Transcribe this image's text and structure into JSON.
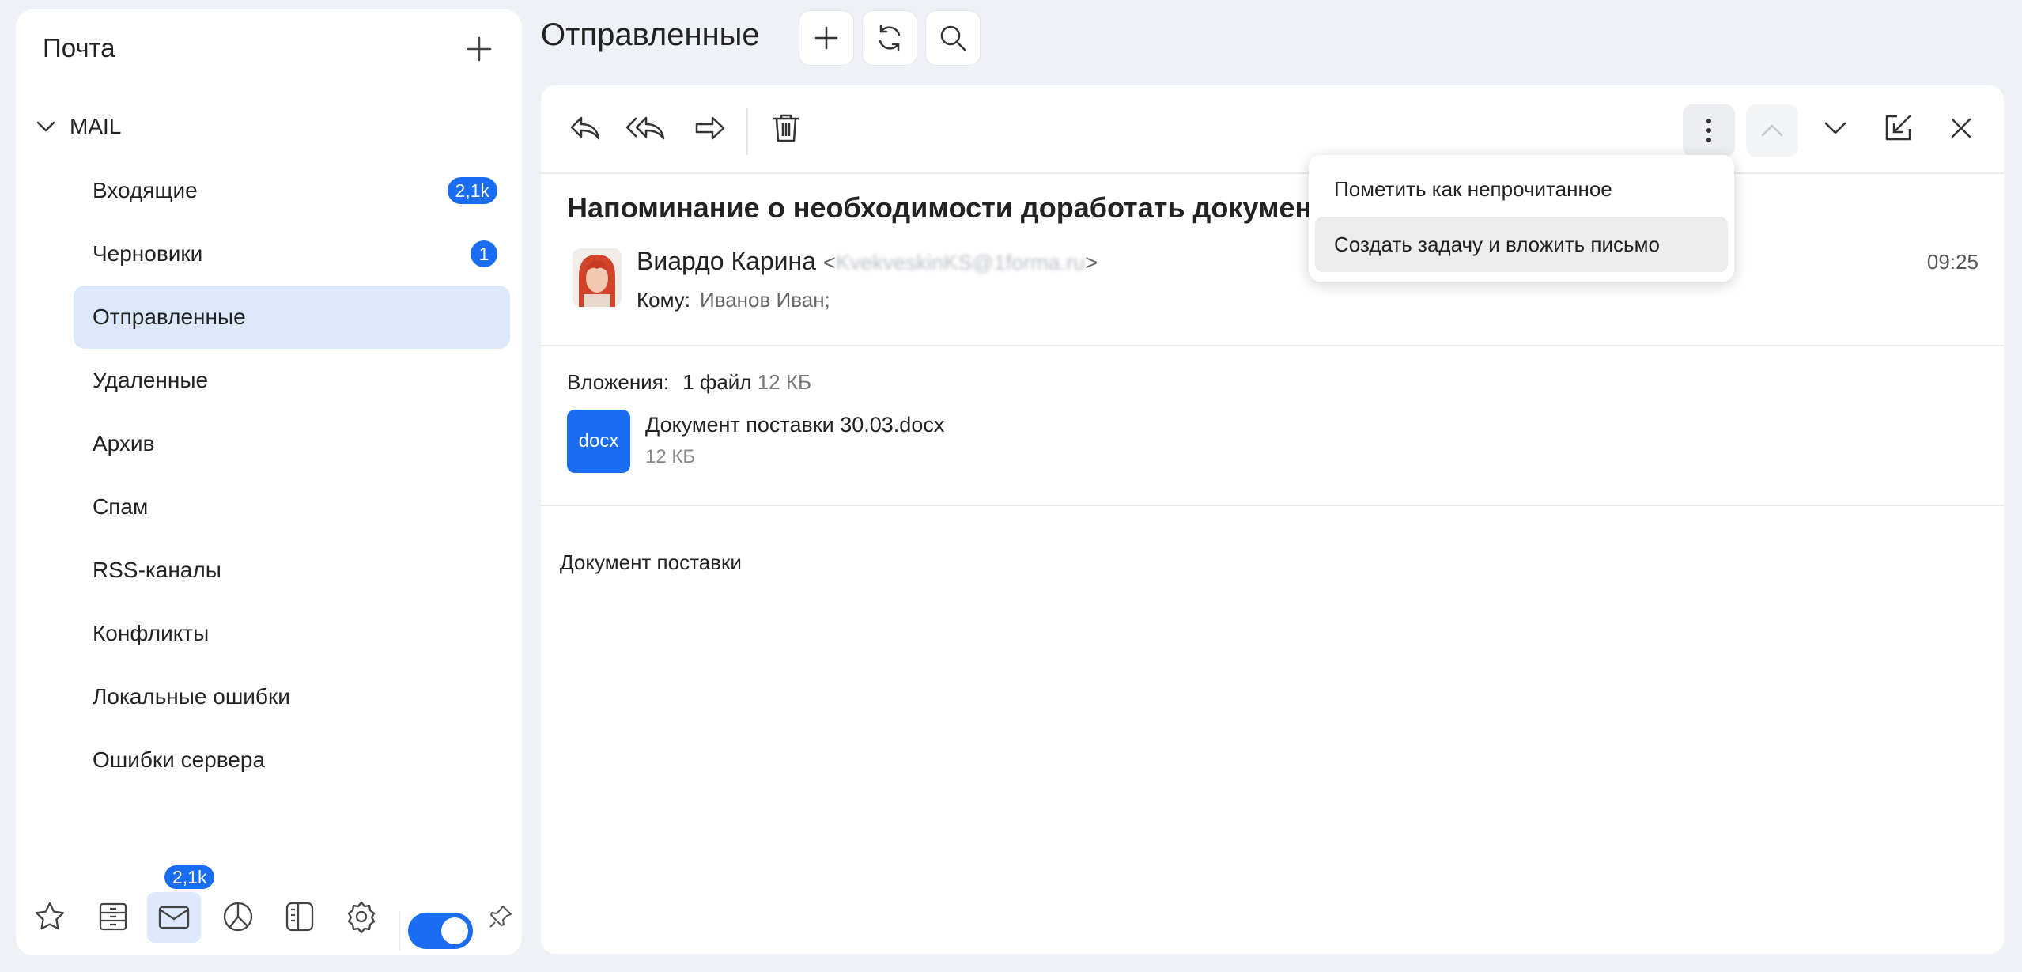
{
  "sidebar": {
    "title": "Почта",
    "account": "MAIL",
    "folders": [
      {
        "label": "Входящие",
        "badge": "2,1k"
      },
      {
        "label": "Черновики",
        "badge": "1"
      },
      {
        "label": "Отправленные",
        "active": true
      },
      {
        "label": "Удаленные"
      },
      {
        "label": "Архив"
      },
      {
        "label": "Спам"
      },
      {
        "label": "RSS-каналы"
      },
      {
        "label": "Конфликты"
      },
      {
        "label": "Локальные ошибки"
      },
      {
        "label": "Ошибки сервера"
      }
    ],
    "bottom": {
      "mail_badge": "2,1k",
      "icons": [
        "star-icon",
        "archive-icon",
        "mail-icon",
        "chart-icon",
        "book-icon",
        "gear-icon",
        "pin-icon"
      ],
      "toggle_on": true
    }
  },
  "header": {
    "title": "Отправленные"
  },
  "message": {
    "subject": "Напоминание о необходимости доработать документ",
    "sender_name": "Виардо Карина",
    "sender_email": "KvekveskinKS@1forma.ru",
    "time": "09:25",
    "to_label": "Кому:",
    "to_value": "Иванов Иван;",
    "attachments_label": "Вложения:",
    "attachments_count": "1 файл",
    "attachments_total": "12 КБ",
    "attachment": {
      "ext": "docx",
      "name": "Документ поставки 30.03.docx",
      "size": "12 КБ"
    },
    "body": "Документ поставки"
  },
  "context_menu": {
    "items": [
      "Пометить как непрочитанное",
      "Создать задачу и вложить письмо"
    ]
  },
  "colors": {
    "accent": "#1a6cf0",
    "active_bg": "#dce8fb",
    "background": "#eef1f5"
  }
}
